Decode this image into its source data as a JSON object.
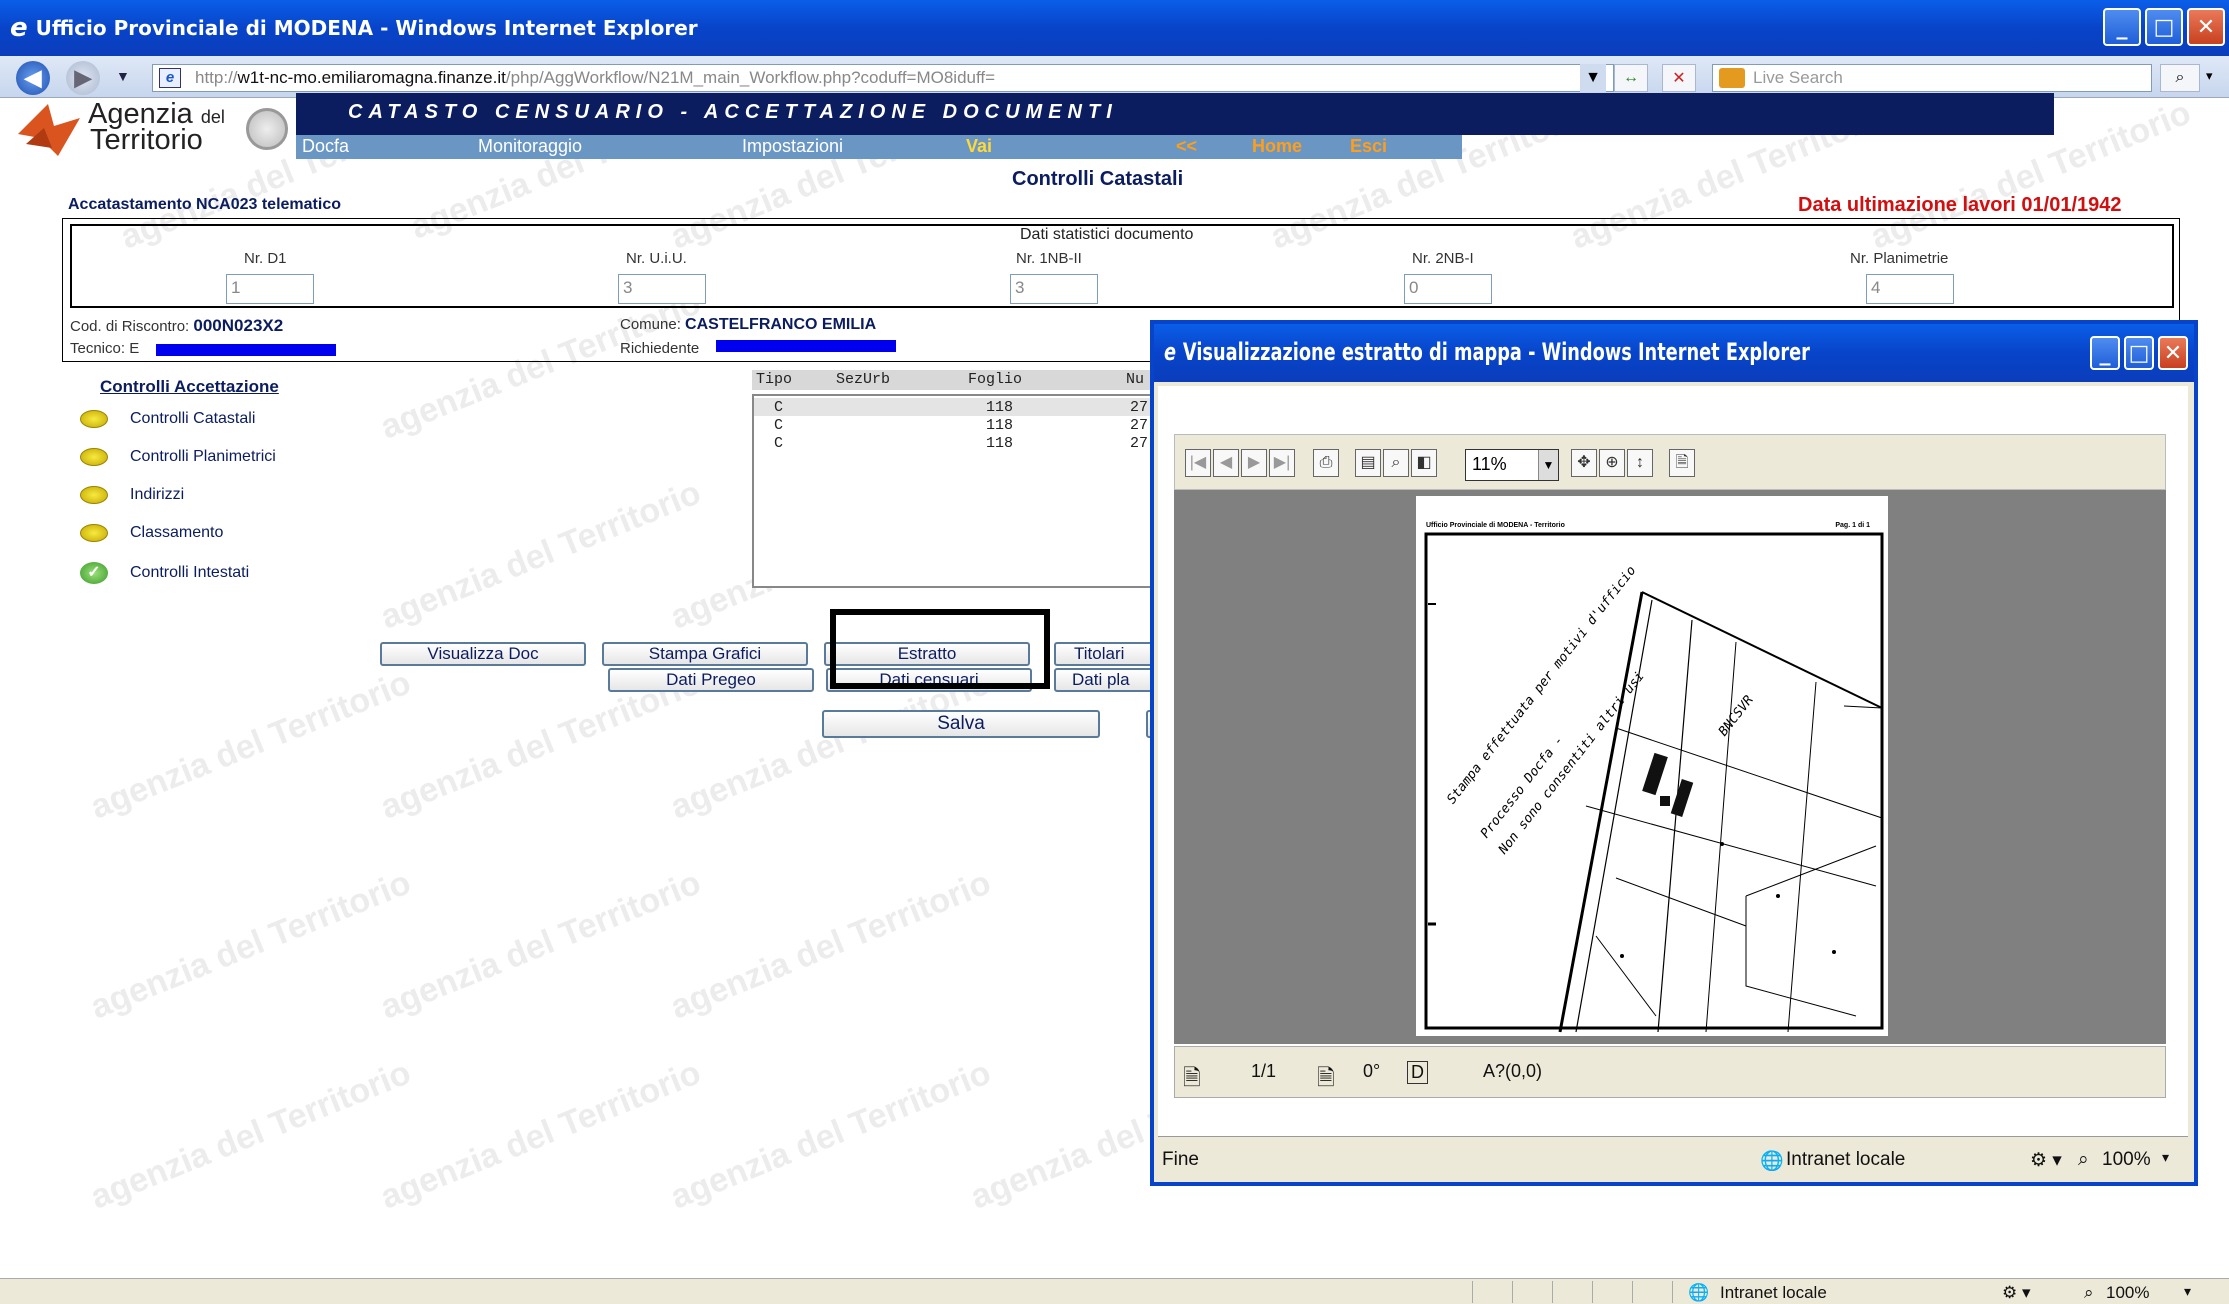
{
  "browser": {
    "title": "Ufficio Provinciale di MODENA - Windows Internet Explorer",
    "url_prefix": "http://",
    "url_host": "w1t-nc-mo.emiliaromagna.finanze.it",
    "url_path": "/php/AggWorkflow/N21M_main_Workflow.php?coduff=MO8iduff=",
    "search_placeholder": "Live Search"
  },
  "header": {
    "logo_line1": "Agenzia",
    "logo_del": "del",
    "logo_line2": "Territorio",
    "banner": "CATASTO CENSUARIO - ACCETTAZIONE DOCUMENTI",
    "menu": {
      "docfa": "Docfa",
      "monitoraggio": "Monitoraggio",
      "impostazioni": "Impostazioni",
      "vai": "Vai",
      "back": "<<",
      "home": "Home",
      "esci": "Esci"
    }
  },
  "watermark": "agenzia del Territorio",
  "page": {
    "title": "Controlli Catastali",
    "subtitle": "Accatastamento NCA023 telematico",
    "data_lavori": "Data ultimazione lavori 01/01/1942"
  },
  "stats": {
    "heading": "Dati statistici documento",
    "fields": [
      {
        "label": "Nr. D1",
        "value": "1"
      },
      {
        "label": "Nr. U.i.U.",
        "value": "3"
      },
      {
        "label": "Nr. 1NB-II",
        "value": "3"
      },
      {
        "label": "Nr. 2NB-I",
        "value": "0"
      },
      {
        "label": "Nr. Planimetrie",
        "value": "4"
      }
    ],
    "cod_label": "Cod. di Riscontro:",
    "cod_value": "000N023X2",
    "comune_label": "Comune:",
    "comune_value": "CASTELFRANCO EMILIA",
    "tecnico_label": "Tecnico: E",
    "richiedente_label": "Richiedente"
  },
  "controls": {
    "title": "Controlli Accettazione",
    "items": [
      {
        "label": "Controlli Catastali",
        "status": "pending"
      },
      {
        "label": "Controlli Planimetrici",
        "status": "pending"
      },
      {
        "label": "Indirizzi",
        "status": "pending"
      },
      {
        "label": "Classamento",
        "status": "pending"
      },
      {
        "label": "Controlli Intestati",
        "status": "ok"
      }
    ]
  },
  "table": {
    "headers": [
      "Tipo",
      "SezUrb",
      "Foglio",
      "Nu"
    ],
    "rows": [
      [
        "C",
        "",
        "118",
        "27"
      ],
      [
        "C",
        "",
        "118",
        "27"
      ],
      [
        "C",
        "",
        "118",
        "27"
      ]
    ]
  },
  "buttons": {
    "visualizza_doc": "Visualizza Doc",
    "stampa_grafici": "Stampa Grafici",
    "estratto": "Estratto",
    "titolari": "Titolari",
    "dati_pregeo": "Dati Pregeo",
    "dati_censuari": "Dati censuari",
    "dati_pla": "Dati pla",
    "salva": "Salva"
  },
  "popup": {
    "title": "Visualizzazione estratto di mappa - Windows Internet Explorer",
    "zoom": "11%",
    "map_header_left": "Ufficio Provinciale di MODENA - Territorio",
    "map_header_right": "Pag. 1 di 1",
    "map_stamp_lines": [
      "Stampa effettuata per motivi d'ufficio",
      "Processo Docfa -",
      "Non sono consentiti altri usi"
    ],
    "map_label": "BNCSVR",
    "page_indicator": "1/1",
    "rotation": "0°",
    "coords": "A?(0,0)",
    "status_text": "Fine",
    "zone": "Intranet locale",
    "zoom_level": "100%"
  },
  "statusbar": {
    "zone": "Intranet locale",
    "zoom": "100%"
  }
}
